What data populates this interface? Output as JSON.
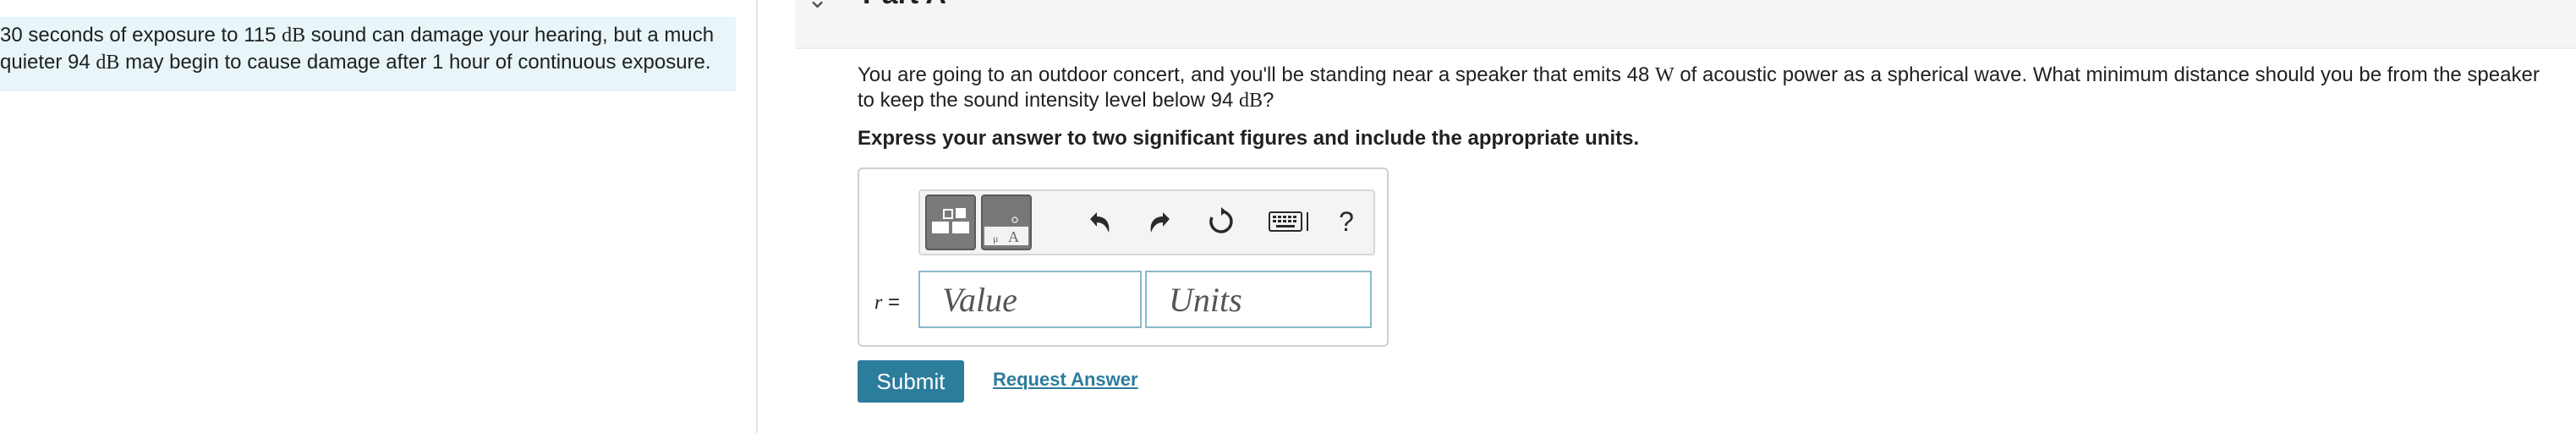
{
  "intro": {
    "line1_prefix": "30 seconds of exposure to 115 ",
    "unit_db": "dB",
    "line1_suffix": " sound can damage your hearing, but a much",
    "line2_prefix": "quieter 94 ",
    "line2_suffix": " may begin to cause damage after 1 hour of continuous exposure."
  },
  "part": {
    "title": "Part A"
  },
  "question": {
    "text_a": "You are going to an outdoor concert, and you'll be standing near a speaker that emits 48 ",
    "unit_w": "W",
    "text_b": " of acoustic power as a spherical wave. What minimum distance should you be from the speaker to keep the sound intensity level below 94 ",
    "unit_db": "dB",
    "text_c": "?"
  },
  "instruction": "Express your answer to two significant figures and include the appropriate units.",
  "answer": {
    "variable": "r",
    "equals": " =",
    "value_placeholder": "Value",
    "units_placeholder": "Units"
  },
  "toolbar": {
    "icons": [
      "templates-icon",
      "special-chars-icon",
      "undo-icon",
      "redo-icon",
      "reset-icon",
      "keyboard-icon",
      "help-icon"
    ],
    "help_label": "?"
  },
  "actions": {
    "submit_label": "Submit",
    "request_label": "Request Answer"
  },
  "colors": {
    "accent": "#2c7c9c",
    "info_bg": "#e8f6f9"
  }
}
